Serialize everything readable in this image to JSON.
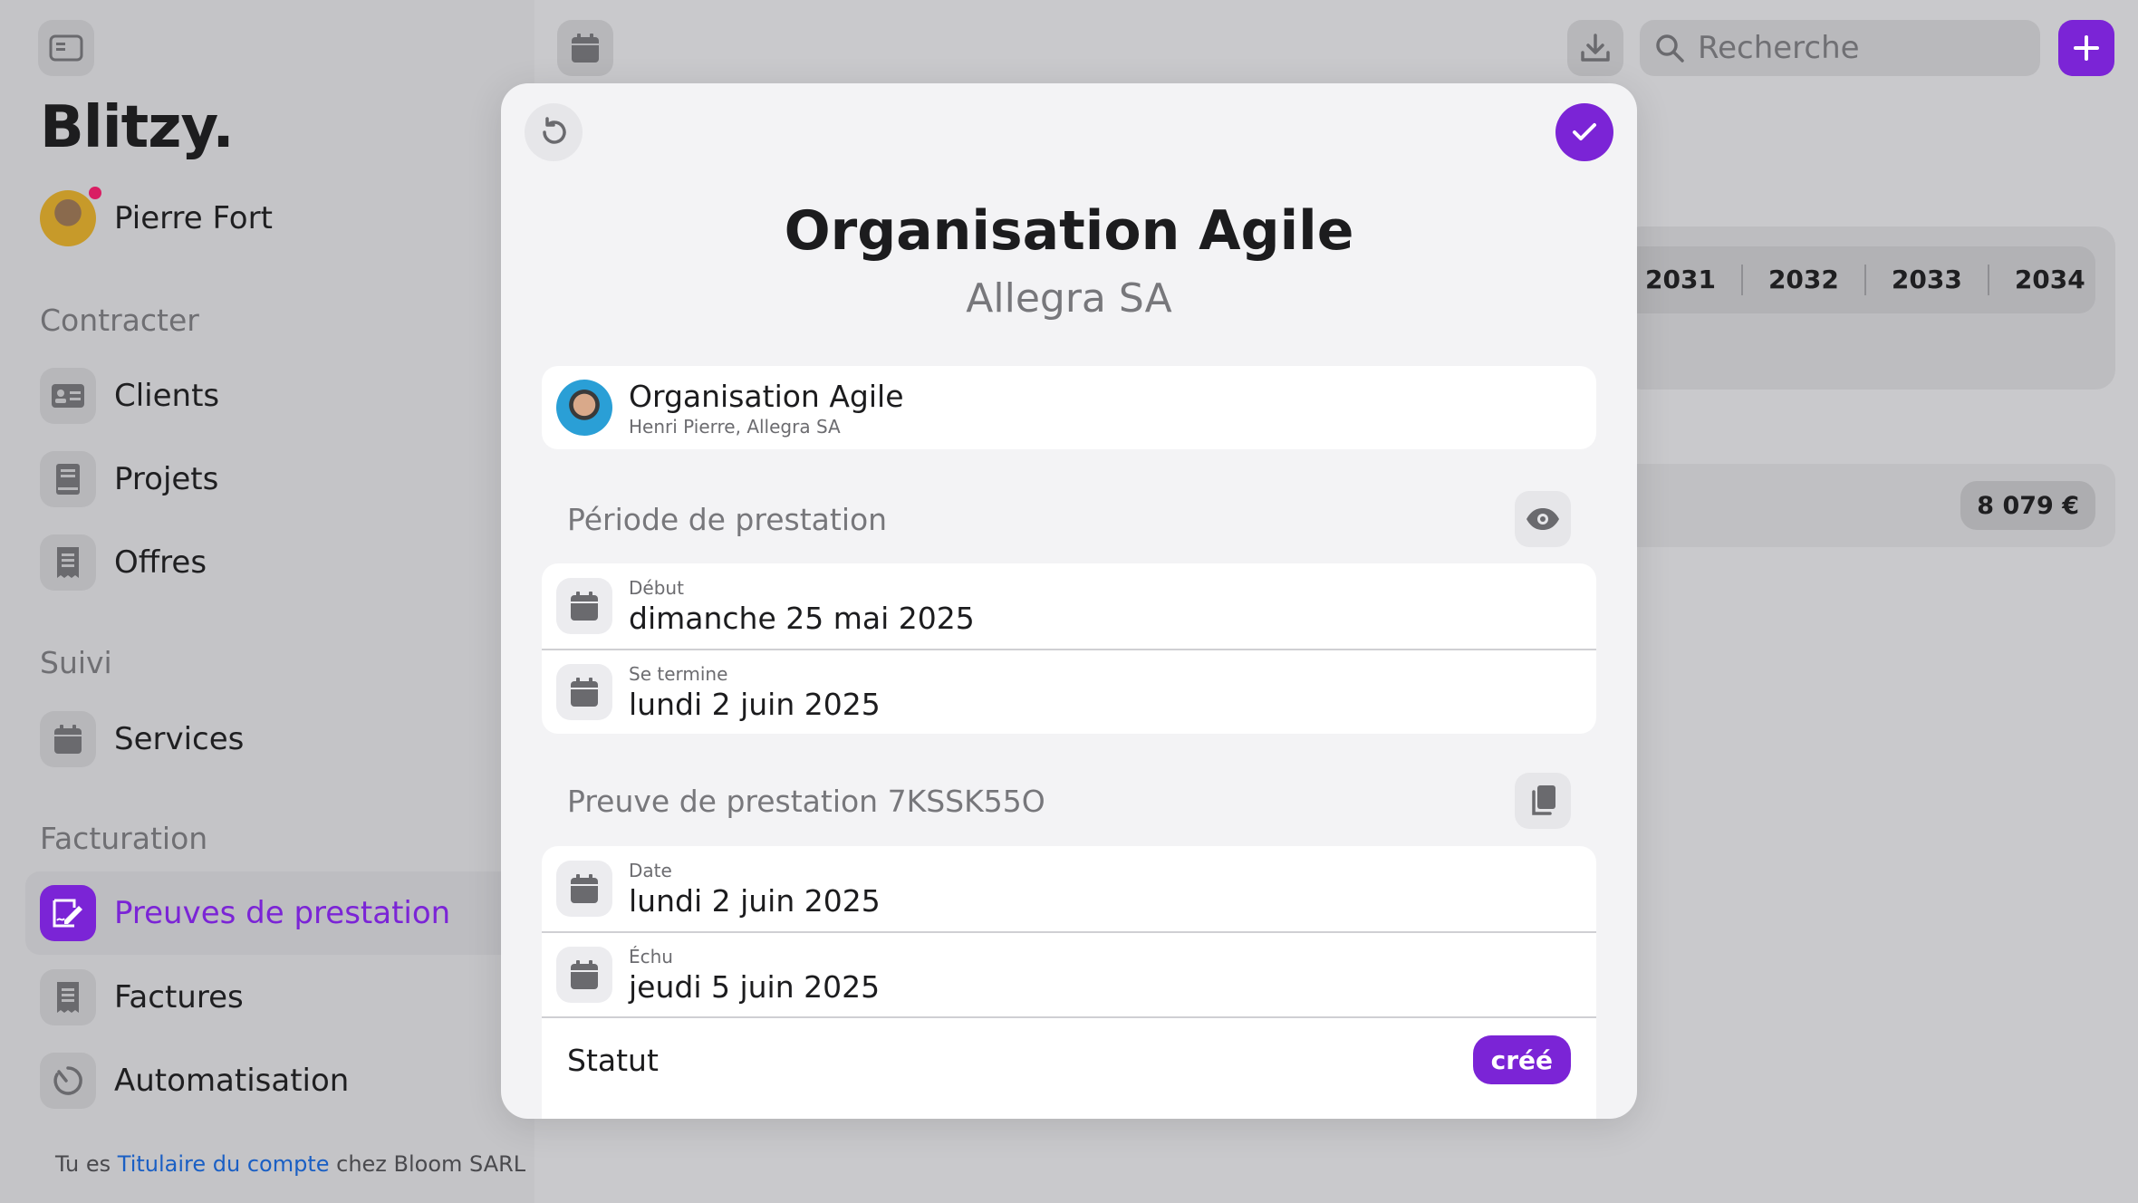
{
  "app": {
    "logo": "Blitzy."
  },
  "user": {
    "name": "Pierre Fort"
  },
  "sidebar": {
    "sections": [
      {
        "title": "Contracter"
      },
      {
        "title": "Suivi"
      },
      {
        "title": "Facturation"
      }
    ],
    "items": [
      {
        "label": "Clients",
        "icon": "contact-card-icon"
      },
      {
        "label": "Projets",
        "icon": "book-icon"
      },
      {
        "label": "Offres",
        "icon": "receipt-icon"
      },
      {
        "label": "Services",
        "icon": "calendar-icon"
      },
      {
        "label": "Preuves de prestation",
        "icon": "signature-icon",
        "active": true
      },
      {
        "label": "Factures",
        "icon": "receipt-icon"
      },
      {
        "label": "Automatisation",
        "icon": "timer-icon"
      }
    ],
    "footer": {
      "prefix": "Tu es ",
      "link": "Titulaire du compte",
      "suffix": " chez Bloom SARL"
    }
  },
  "toolbar": {
    "search_placeholder": "Recherche"
  },
  "background": {
    "years": [
      "2031",
      "2032",
      "2033",
      "2034"
    ],
    "amount": "8 079 €"
  },
  "modal": {
    "title": "Organisation Agile",
    "subtitle": "Allegra SA",
    "project": {
      "name": "Organisation Agile",
      "meta": "Henri Pierre, Allegra SA"
    },
    "period": {
      "title": "Période de prestation",
      "start_label": "Début",
      "start_value": "dimanche 25 mai 2025",
      "end_label": "Se termine",
      "end_value": "lundi 2 juin 2025"
    },
    "proof": {
      "title": "Preuve de prestation 7KSSK55O",
      "date_label": "Date",
      "date_value": "lundi 2 juin 2025",
      "due_label": "Échu",
      "due_value": "jeudi 5 juin 2025"
    },
    "status": {
      "label": "Statut",
      "value": "créé"
    }
  },
  "colors": {
    "accent": "#7b24d6",
    "link": "#1a5fc4",
    "notification": "#d91e63"
  }
}
